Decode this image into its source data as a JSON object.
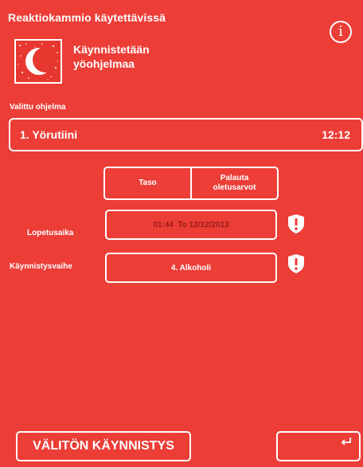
{
  "header": {
    "title": "Reaktiokammio käytettävissä",
    "info_icon": "info-icon",
    "info_glyph": "i"
  },
  "mode": {
    "icon": "moon-night-icon",
    "line1": "Käynnistetään",
    "line2": "yöohjelmaa"
  },
  "program": {
    "section_label": "Valittu ohjelma",
    "name": "1. Yörutiini",
    "time": "12:12"
  },
  "level_controls": {
    "level_label": "Taso",
    "reset_label_line1": "Palauta",
    "reset_label_line2": "oletusarvot"
  },
  "end_time": {
    "label": "Lopetusaika",
    "value": "01:44  To 12/12/2013",
    "warning_icon": "shield-warning-icon"
  },
  "start_step": {
    "label": "Käynnistysvaihe",
    "value": "4. Alkoholi",
    "warning_icon": "shield-warning-icon"
  },
  "footer": {
    "start_now_label": "VÄLITÖN KÄYNNISTYS",
    "back_icon": "back-arrow-icon",
    "back_glyph": "⮌"
  },
  "colors": {
    "background": "#ec3d37",
    "text": "#ffffff",
    "dim_text": "#9a1c17"
  }
}
